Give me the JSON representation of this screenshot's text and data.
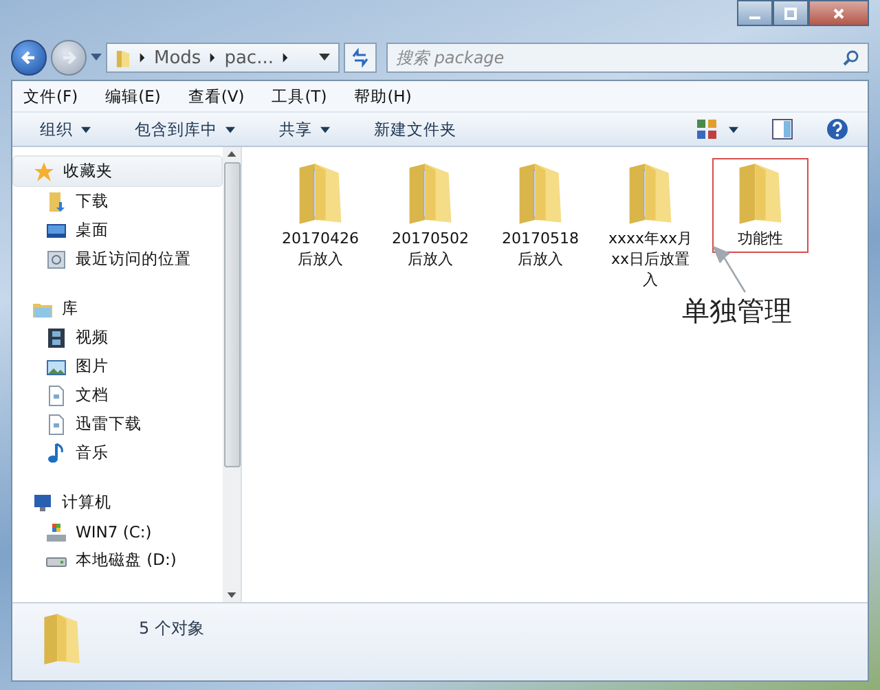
{
  "address": {
    "crumbs": [
      "Mods",
      "pac..."
    ]
  },
  "search": {
    "placeholder": "搜索 package"
  },
  "menu": [
    "文件(F)",
    "编辑(E)",
    "查看(V)",
    "工具(T)",
    "帮助(H)"
  ],
  "toolbar": [
    {
      "label": "组织",
      "dropdown": true
    },
    {
      "label": "包含到库中",
      "dropdown": true
    },
    {
      "label": "共享",
      "dropdown": true
    },
    {
      "label": "新建文件夹",
      "dropdown": false
    }
  ],
  "nav": [
    {
      "label": "收藏夹",
      "kind": "star",
      "selected": true,
      "children": [
        {
          "label": "下载",
          "kind": "download",
          "selected": false
        },
        {
          "label": "桌面",
          "kind": "desktop",
          "selected": false
        },
        {
          "label": "最近访问的位置",
          "kind": "recent",
          "selected": false
        }
      ]
    },
    {
      "label": "库",
      "kind": "library",
      "selected": false,
      "children": [
        {
          "label": "视频",
          "kind": "video",
          "selected": false
        },
        {
          "label": "图片",
          "kind": "picture",
          "selected": false
        },
        {
          "label": "文档",
          "kind": "document",
          "selected": false
        },
        {
          "label": "迅雷下载",
          "kind": "document",
          "selected": false
        },
        {
          "label": "音乐",
          "kind": "music",
          "selected": false
        }
      ]
    },
    {
      "label": "计算机",
      "kind": "computer",
      "selected": false,
      "children": [
        {
          "label": "WIN7 (C:)",
          "kind": "system-drive",
          "selected": false
        },
        {
          "label": "本地磁盘 (D:)",
          "kind": "drive",
          "selected": false
        }
      ]
    }
  ],
  "files": [
    {
      "name": "20170426后放入",
      "kind": "full",
      "highlighted": false
    },
    {
      "name": "20170502后放入",
      "kind": "full",
      "highlighted": false
    },
    {
      "name": "20170518后放入",
      "kind": "full",
      "highlighted": false
    },
    {
      "name": "xxxx年xx月xx日后放置入",
      "kind": "full",
      "highlighted": false
    },
    {
      "name": "功能性",
      "kind": "empty",
      "highlighted": true
    }
  ],
  "annotation": {
    "text": "单独管理"
  },
  "status_bar": {
    "count": "5 个对象"
  }
}
